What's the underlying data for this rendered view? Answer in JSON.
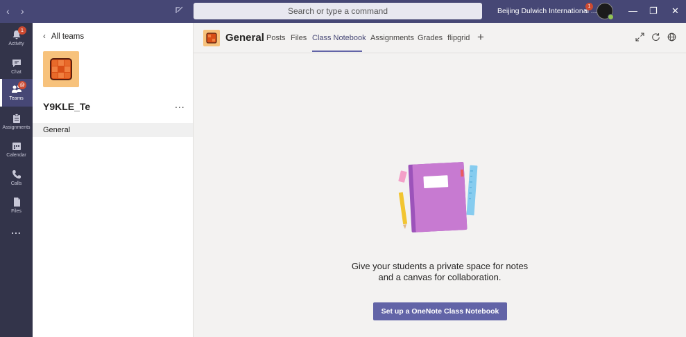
{
  "titlebar": {
    "search_placeholder": "Search or type a command",
    "org_name": "Beijing Dulwich International ...",
    "org_badge": "1"
  },
  "rail": {
    "items": [
      {
        "label": "Activity",
        "badge": "1"
      },
      {
        "label": "Chat"
      },
      {
        "label": "Teams",
        "badge": "@"
      },
      {
        "label": "Assignments"
      },
      {
        "label": "Calendar"
      },
      {
        "label": "Calls"
      },
      {
        "label": "Files"
      }
    ],
    "more": "..."
  },
  "panel": {
    "back_label": "All teams",
    "team_name": "Y9KLE_Te",
    "more": "...",
    "channels": [
      "General"
    ]
  },
  "header": {
    "channel_name": "General",
    "tabs": [
      "Posts",
      "Files",
      "Class Notebook",
      "Assignments",
      "Grades",
      "flipgrid"
    ],
    "active_tab": "Class Notebook",
    "add": "+"
  },
  "main": {
    "message_line1": "Give your students a private space for notes",
    "message_line2": "and a canvas for collaboration.",
    "cta_label": "Set up a OneNote Class Notebook"
  },
  "colors": {
    "titlebar": "#464775",
    "rail": "#33344a",
    "accent": "#6264a7",
    "badge": "#cc4a31",
    "team_tile": "#f7c27c"
  }
}
